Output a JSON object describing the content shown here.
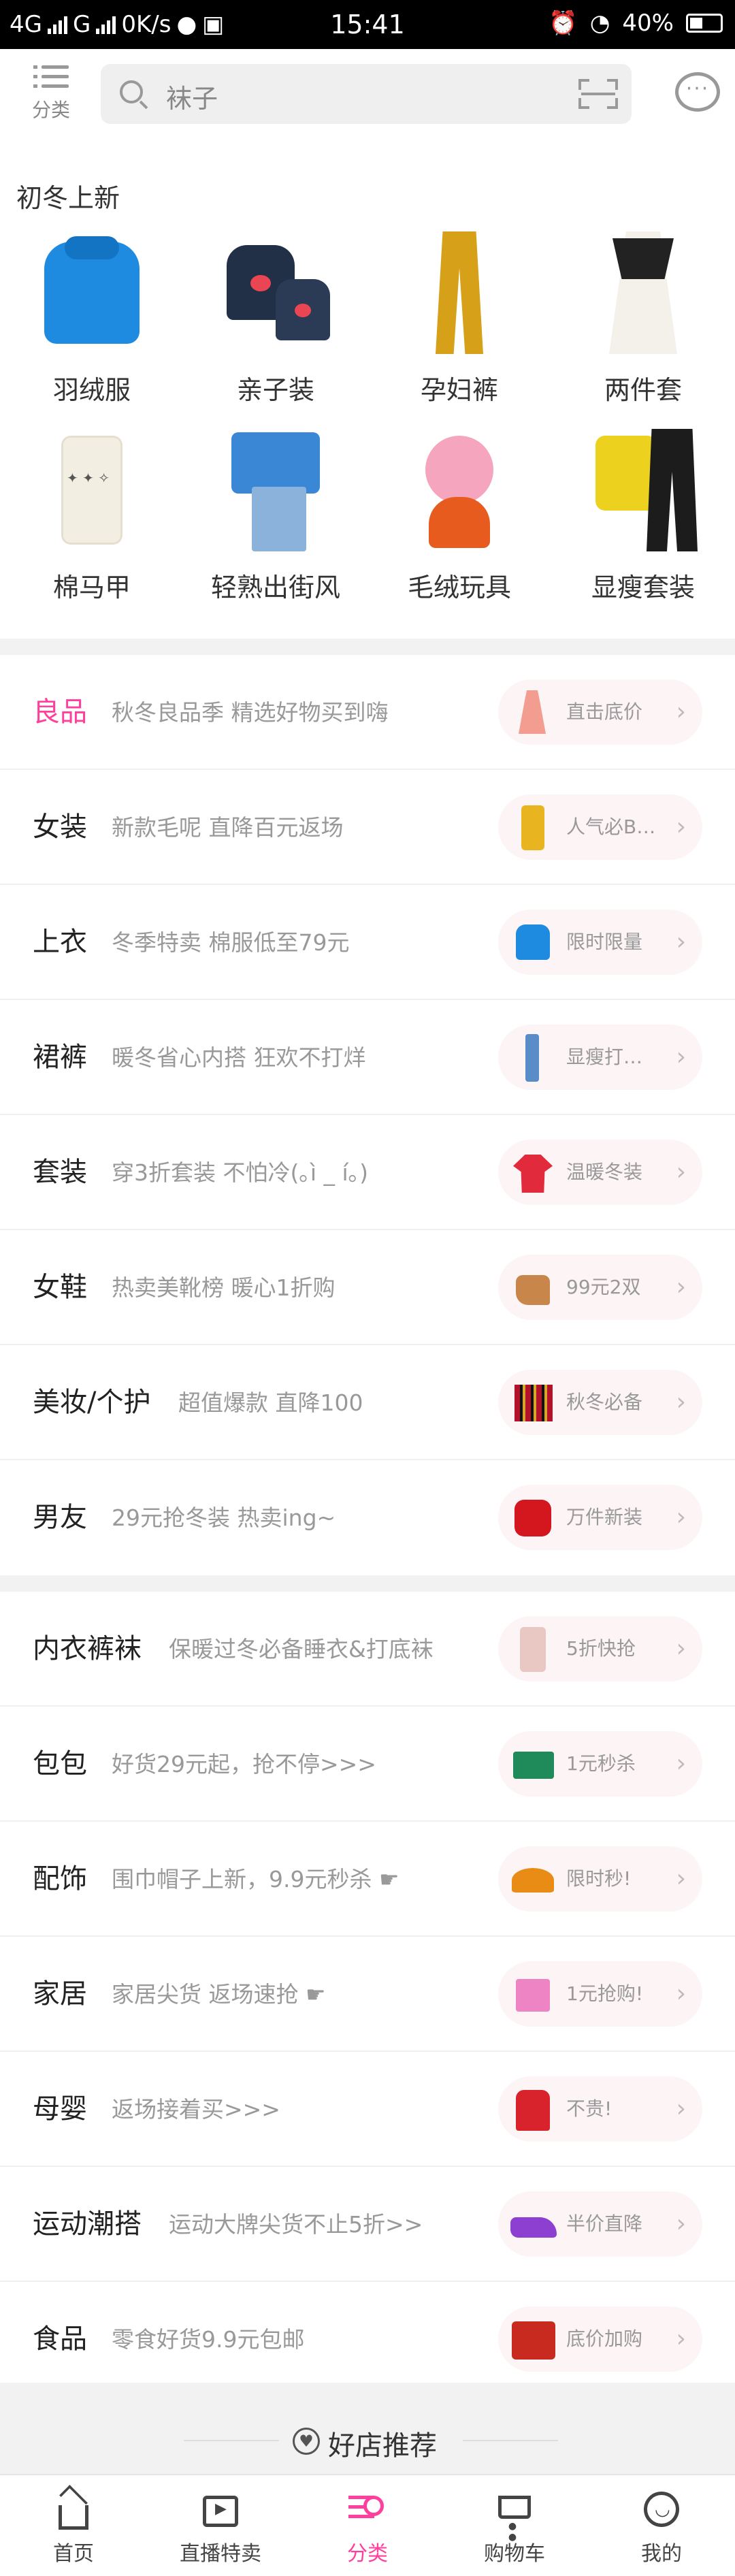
{
  "status_bar": {
    "network_1": "4G",
    "network_2": "G",
    "speed": "0K/s",
    "time": "15:41",
    "battery": "40%"
  },
  "header": {
    "category_label": "分类",
    "search_placeholder": "袜子"
  },
  "new_arrivals": {
    "title": "初冬上新",
    "items": [
      {
        "label": "羽绒服",
        "icon": "down-jacket"
      },
      {
        "label": "亲子装",
        "icon": "parent-child-hoodies"
      },
      {
        "label": "孕妇裤",
        "icon": "maternity-pants"
      },
      {
        "label": "两件套",
        "icon": "two-piece-dress"
      },
      {
        "label": "棉马甲",
        "icon": "cotton-vest"
      },
      {
        "label": "轻熟出街风",
        "icon": "sweater-skirt"
      },
      {
        "label": "毛绒玩具",
        "icon": "plush-toy"
      },
      {
        "label": "显瘦套装",
        "icon": "slim-set"
      }
    ]
  },
  "categories_group1": [
    {
      "name": "良品",
      "desc": "秋冬良品季 精选好物买到嗨",
      "tag": "直击底价",
      "icon": "dress",
      "highlight": true
    },
    {
      "name": "女装",
      "desc": "新款毛呢 直降百元返场",
      "tag": "人气必B…",
      "icon": "coat"
    },
    {
      "name": "上衣",
      "desc": "冬季特卖 棉服低至79元",
      "tag": "限时限量",
      "icon": "jacket"
    },
    {
      "name": "裙裤",
      "desc": "暖冬省心内搭 狂欢不打烊",
      "tag": "显瘦打…",
      "icon": "jeans"
    },
    {
      "name": "套装",
      "desc": "穿3折套装 不怕冷(｡ì _ í｡)",
      "tag": "温暖冬装",
      "icon": "red-top"
    },
    {
      "name": "女鞋",
      "desc": "热卖美靴榜  暖心1折购",
      "tag": "99元2双",
      "icon": "boot"
    },
    {
      "name": "美妆/个护",
      "desc": "超值爆款  直降100",
      "tag": "秋冬必备",
      "icon": "lipstick"
    },
    {
      "name": "男友",
      "desc": "29元抢冬装 热卖ing~",
      "tag": "万件新装",
      "icon": "bomber"
    }
  ],
  "categories_group2": [
    {
      "name": "内衣裤袜",
      "desc": "保暖过冬必备睡衣&打底袜",
      "tag": "5折快抢",
      "icon": "pajama"
    },
    {
      "name": "包包",
      "desc": "好货29元起，抢不停>>>",
      "tag": "1元秒杀",
      "icon": "bag"
    },
    {
      "name": "配饰",
      "desc": "围巾帽子上新，9.9元秒杀 ☛",
      "tag": "限时秒!",
      "icon": "hat"
    },
    {
      "name": "家居",
      "desc": "家居尖货 返场速抢 ☛",
      "tag": "1元抢购!",
      "icon": "box"
    },
    {
      "name": "母婴",
      "desc": "返场接着买>>>",
      "tag": "不贵!",
      "icon": "kid-jacket"
    },
    {
      "name": "运动潮搭",
      "desc": "运动大牌尖货不止5折>>",
      "tag": "半价直降",
      "icon": "sneaker"
    },
    {
      "name": "食品",
      "desc": "零食好货9.9元包邮",
      "tag": "底价加购",
      "icon": "snack"
    }
  ],
  "recommend": {
    "title": "好店推荐"
  },
  "bottom_nav": [
    {
      "label": "首页",
      "icon": "home-icon"
    },
    {
      "label": "直播特卖",
      "icon": "live-icon"
    },
    {
      "label": "分类",
      "icon": "category-icon",
      "active": true
    },
    {
      "label": "购物车",
      "icon": "cart-icon"
    },
    {
      "label": "我的",
      "icon": "profile-icon"
    }
  ],
  "colors": {
    "accent": "#ff3f9d",
    "divider": "#f2f2f2"
  }
}
